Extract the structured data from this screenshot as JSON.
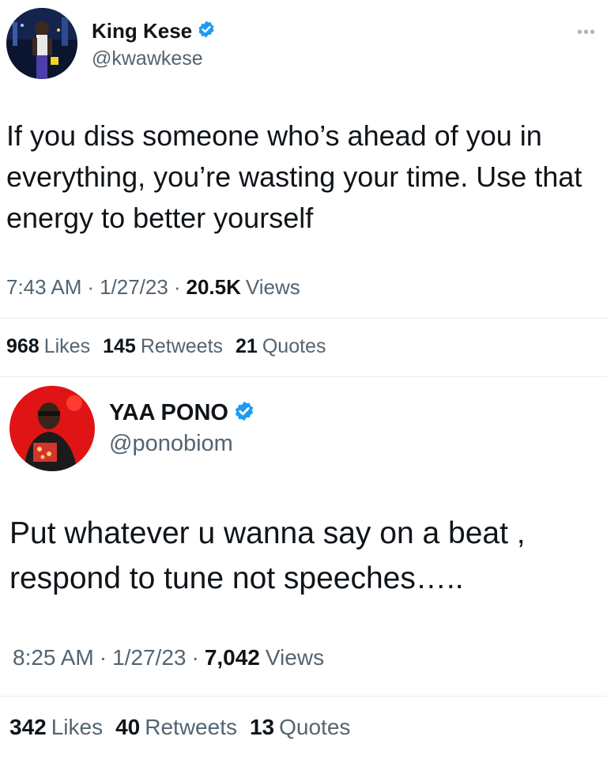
{
  "tweet1": {
    "name": "King Kese",
    "handle": "@kwawkese",
    "more": "•••",
    "text": "If you diss someone who’s ahead of you in everything, you’re wasting your time. Use that energy to better yourself",
    "time": "7:43 AM",
    "date": "1/27/23",
    "views_count": "20.5K",
    "views_label": "Views",
    "likes_count": "968",
    "likes_label": "Likes",
    "retweets_count": "145",
    "retweets_label": "Retweets",
    "quotes_count": "21",
    "quotes_label": "Quotes"
  },
  "tweet2": {
    "name": "YAA PONO",
    "handle": "@ponobiom",
    "text": "Put whatever u wanna say on a beat , respond to tune not speeches…..",
    "time": "8:25 AM",
    "date": "1/27/23",
    "views_count": "7,042",
    "views_label": "Views",
    "likes_count": "342",
    "likes_label": "Likes",
    "retweets_count": "40",
    "retweets_label": "Retweets",
    "quotes_count": "13",
    "quotes_label": "Quotes"
  },
  "separator": "·",
  "colors": {
    "verified": "#1d9bf0",
    "secondary_text": "#536471",
    "divider": "#e6ecf0"
  },
  "icons": [
    "avatar-photo",
    "verified-badge-icon",
    "more-options-icon"
  ]
}
